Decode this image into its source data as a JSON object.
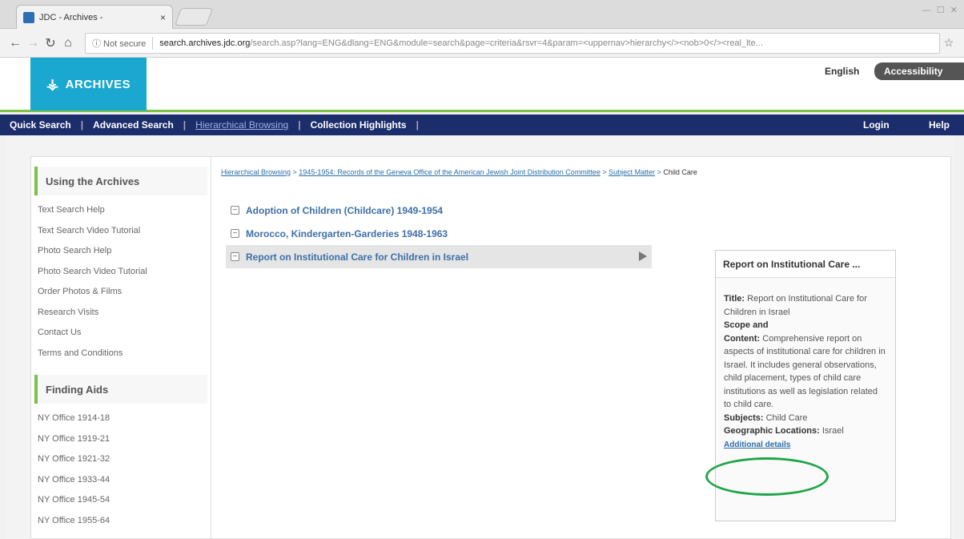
{
  "browser": {
    "tab_title": "JDC - Archives -",
    "tab_close": "×",
    "window_controls": "— ☐ ✕",
    "security": "ⓘ Not secure",
    "url_domain": "search.archives.jdc.org",
    "url_path": "/search.asp?lang=ENG&dlang=ENG&module=search&page=criteria&rsvr=4&param=<uppernav>hierarchy</><nob>0</><real_lte..."
  },
  "header": {
    "logo_text": "ARCHIVES",
    "language": "English",
    "accessibility": "Accessibility"
  },
  "nav": {
    "quick_search": "Quick Search",
    "advanced_search": "Advanced Search",
    "hierarchical_browsing": "Hierarchical Browsing",
    "collection_highlights": "Collection Highlights",
    "login": "Login",
    "help": "Help"
  },
  "sidebar": {
    "section1_title": "Using the Archives",
    "section1_items": [
      "Text Search Help",
      "Text Search Video Tutorial",
      "Photo Search Help",
      "Photo Search Video Tutorial",
      "Order Photos & Films",
      "Research Visits",
      "Contact Us",
      "Terms and Conditions"
    ],
    "section2_title": "Finding Aids",
    "section2_items": [
      "NY Office 1914-18",
      "NY Office 1919-21",
      "NY Office 1921-32",
      "NY Office 1933-44",
      "NY Office 1945-54",
      "NY Office 1955-64"
    ]
  },
  "breadcrumb": {
    "crumb1": "Hierarchical Browsing",
    "crumb2": "1945-1954: Records of the Geneva Office of the American Jewish Joint Distribution Committee",
    "crumb3": "Subject Matter",
    "current": "Child Care",
    "separator": " > "
  },
  "tree": {
    "items": [
      "Adoption of Children (Childcare) 1949-1954",
      "Morocco, Kindergarten-Garderies 1948-1963",
      "Report on Institutional Care for Children in Israel"
    ],
    "toggle_symbol": "−"
  },
  "detail": {
    "header": "Report on Institutional Care ...",
    "title_label": "Title:",
    "title_value": "Report on Institutional Care for Children in Israel",
    "scope_label_1": "Scope and",
    "scope_label_2": "Content:",
    "scope_value": "Comprehensive report on aspects of institutional care for children in Israel. It includes general observations, child placement, types of child care institutions as well as legislation related to child care.",
    "subjects_label": "Subjects:",
    "subjects_value": "Child Care",
    "geo_label": "Geographic Locations:",
    "geo_value": "Israel",
    "additional_details": "Additional details"
  }
}
